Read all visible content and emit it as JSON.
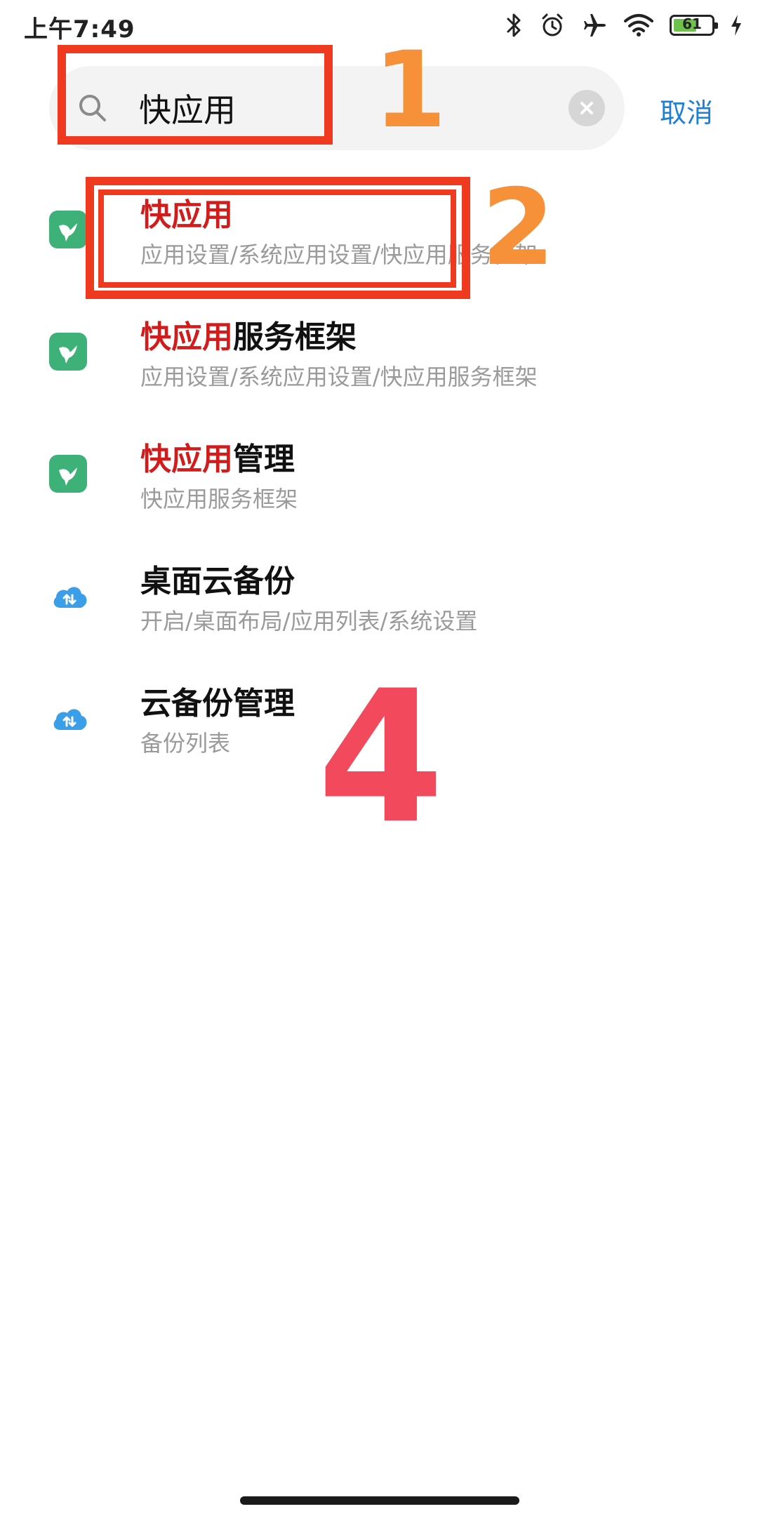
{
  "status_bar": {
    "time": "上午7:49",
    "battery_level": "61",
    "battery_fraction": 0.61,
    "icons": [
      "bluetooth-icon",
      "alarm-icon",
      "airplane-icon",
      "wifi-icon",
      "battery-icon",
      "charging-icon"
    ]
  },
  "search": {
    "query": "快应用",
    "cancel_label": "取消"
  },
  "results": [
    {
      "icon": "hummingbird-app-icon",
      "title_highlight": "快应用",
      "title_rest": "",
      "path": "应用设置/系统应用设置/快应用服务框架"
    },
    {
      "icon": "hummingbird-app-icon",
      "title_highlight": "快应用",
      "title_rest": "服务框架",
      "path": "应用设置/系统应用设置/快应用服务框架"
    },
    {
      "icon": "hummingbird-app-icon",
      "title_highlight": "快应用",
      "title_rest": "管理",
      "path": "快应用服务框架"
    },
    {
      "icon": "cloud-sync-icon",
      "title_highlight": "",
      "title_rest": "桌面云备份",
      "path": "开启/桌面布局/应用列表/系统设置"
    },
    {
      "icon": "cloud-sync-icon",
      "title_highlight": "",
      "title_rest": "云备份管理",
      "path": "备份列表"
    }
  ],
  "annotations": {
    "label_1": "1",
    "label_2": "2",
    "label_4": "4",
    "color_red_box": "#ef3a20",
    "color_orange_num": "#f6913a",
    "color_pink_num": "#f24a5c"
  },
  "colors": {
    "highlight": "#d21c1c",
    "accent_blue": "#1e7fd6",
    "app_icon_green": "#3eb178",
    "cloud_icon_blue": "#3a9ee8"
  }
}
